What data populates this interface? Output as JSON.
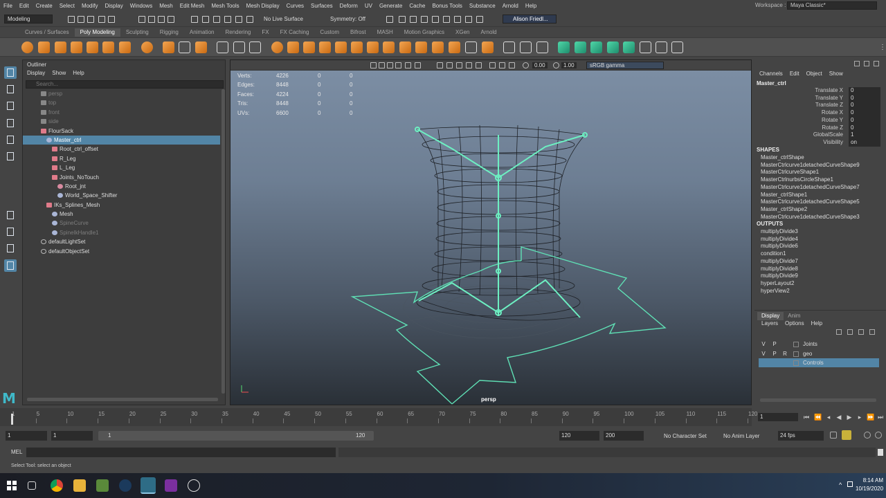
{
  "menubar": {
    "items": [
      "File",
      "Edit",
      "Create",
      "Select",
      "Modify",
      "Display",
      "Windows",
      "Mesh",
      "Edit Mesh",
      "Mesh Tools",
      "Mesh Display",
      "Curves",
      "Surfaces",
      "Deform",
      "UV",
      "Generate",
      "Cache",
      "Bonus Tools",
      "Substance",
      "Arnold",
      "Help"
    ],
    "workspace_label": "Workspace :",
    "workspace_value": "Maya Classic*"
  },
  "statusline": {
    "mode": "Modeling",
    "no_live_surface": "No Live Surface",
    "symmetry": "Symmetry: Off",
    "user": "Alison Friedl..."
  },
  "shelf": {
    "tabs": [
      "Curves / Surfaces",
      "Poly Modeling",
      "Sculpting",
      "Rigging",
      "Animation",
      "Rendering",
      "FX",
      "FX Caching",
      "Custom",
      "Bifrost",
      "MASH",
      "Motion Graphics",
      "XGen",
      "Arnold"
    ],
    "active_tab": 1
  },
  "outliner": {
    "title": "Outliner",
    "menu": [
      "Display",
      "Show",
      "Help"
    ],
    "search_placeholder": "Search...",
    "items": [
      {
        "label": "persp",
        "indent": 0,
        "icon": "cam",
        "dim": true
      },
      {
        "label": "top",
        "indent": 0,
        "icon": "cam",
        "dim": true
      },
      {
        "label": "front",
        "indent": 0,
        "icon": "cam",
        "dim": true
      },
      {
        "label": "side",
        "indent": 0,
        "icon": "cam",
        "dim": true
      },
      {
        "label": "FlourSack",
        "indent": 0,
        "icon": "grp",
        "dim": false
      },
      {
        "label": "Master_ctrl",
        "indent": 1,
        "icon": "tr",
        "dim": false,
        "selected": true
      },
      {
        "label": "Root_ctrl_offset",
        "indent": 2,
        "icon": "grp",
        "dim": false
      },
      {
        "label": "R_Leg",
        "indent": 2,
        "icon": "grp",
        "dim": false
      },
      {
        "label": "L_Leg",
        "indent": 2,
        "icon": "grp",
        "dim": false
      },
      {
        "label": "Joints_NoTouch",
        "indent": 2,
        "icon": "grp",
        "dim": false
      },
      {
        "label": "Root_jnt",
        "indent": 3,
        "icon": "jt",
        "dim": false
      },
      {
        "label": "World_Space_Shifter",
        "indent": 3,
        "icon": "tr",
        "dim": false
      },
      {
        "label": "IKs_Splines_Mesh",
        "indent": 1,
        "icon": "grp",
        "dim": false
      },
      {
        "label": "Mesh",
        "indent": 2,
        "icon": "tr",
        "dim": false
      },
      {
        "label": "SpineCurve",
        "indent": 2,
        "icon": "tr",
        "dim": true
      },
      {
        "label": "SpineIkHandle1",
        "indent": 2,
        "icon": "tr",
        "dim": true
      },
      {
        "label": "defaultLightSet",
        "indent": 0,
        "icon": "set",
        "dim": false
      },
      {
        "label": "defaultObjectSet",
        "indent": 0,
        "icon": "set",
        "dim": false
      }
    ]
  },
  "viewport": {
    "near": "0.00",
    "far": "1.00",
    "color_space": "sRGB gamma",
    "camera": "persp",
    "hud": [
      {
        "label": "Verts:",
        "value": "4226",
        "a": "0",
        "b": "0"
      },
      {
        "label": "Edges:",
        "value": "8448",
        "a": "0",
        "b": "0"
      },
      {
        "label": "Faces:",
        "value": "4224",
        "a": "0",
        "b": "0"
      },
      {
        "label": "Tris:",
        "value": "8448",
        "a": "0",
        "b": "0"
      },
      {
        "label": "UVs:",
        "value": "6600",
        "a": "0",
        "b": "0"
      }
    ]
  },
  "channelbox": {
    "menu": [
      "Channels",
      "Edit",
      "Object",
      "Show"
    ],
    "object": "Master_ctrl",
    "attributes": [
      {
        "label": "Translate X",
        "value": "0"
      },
      {
        "label": "Translate Y",
        "value": "0"
      },
      {
        "label": "Translate Z",
        "value": "0"
      },
      {
        "label": "Rotate X",
        "value": "0"
      },
      {
        "label": "Rotate Y",
        "value": "0"
      },
      {
        "label": "Rotate Z",
        "value": "0"
      },
      {
        "label": "GlobalScale",
        "value": "1"
      },
      {
        "label": "Visibility",
        "value": "on"
      }
    ],
    "shapes_header": "SHAPES",
    "shapes": [
      "Master_ctrlShape",
      "MasterCtrlcurve1detachedCurveShape9",
      "MasterCtrlcurveShape1",
      "MasterCtrlnurbsCircleShape1",
      "MasterCtrlcurve1detachedCurveShape7",
      "Master_ctrlShape1",
      "MasterCtrlcurve1detachedCurveShape5",
      "Master_ctrlShape2",
      "MasterCtrlcurve1detachedCurveShape3"
    ],
    "outputs_header": "OUTPUTS",
    "outputs": [
      "multiplyDivide3",
      "multiplyDivide4",
      "multiplyDivide6",
      "condition1",
      "multiplyDivide7",
      "multiplyDivide8",
      "multiplyDivide9",
      "hyperLayout2",
      "hyperView2"
    ]
  },
  "layers": {
    "tabs": [
      "Display",
      "Anim"
    ],
    "menu": [
      "Layers",
      "Options",
      "Help"
    ],
    "rows": [
      {
        "v": "V",
        "p": "P",
        "r": "",
        "name": "Joints",
        "selected": false
      },
      {
        "v": "V",
        "p": "P",
        "r": "R",
        "name": "geo",
        "selected": false
      },
      {
        "v": "",
        "p": "",
        "r": "",
        "name": "Controls",
        "selected": true
      }
    ]
  },
  "timeslider": {
    "ticks": [
      "1",
      "5",
      "10",
      "15",
      "20",
      "25",
      "30",
      "35",
      "40",
      "45",
      "50",
      "55",
      "60",
      "65",
      "70",
      "75",
      "80",
      "85",
      "90",
      "95",
      "100",
      "105",
      "110",
      "115",
      "120"
    ],
    "current_frame": "1"
  },
  "range": {
    "start": "1",
    "playback_start": "1",
    "slider_start": "1",
    "slider_end": "120",
    "playback_end": "120",
    "end": "200",
    "character_set": "No Character Set",
    "anim_layer": "No Anim Layer",
    "fps": "24 fps"
  },
  "cmdline": {
    "label": "MEL",
    "help": "Select Tool: select an object"
  },
  "taskbar": {
    "time": "8:14 AM",
    "date": "10/19/2020"
  },
  "colors": {
    "selection": "#5285a6",
    "control_curve": "#5fe0b5"
  }
}
